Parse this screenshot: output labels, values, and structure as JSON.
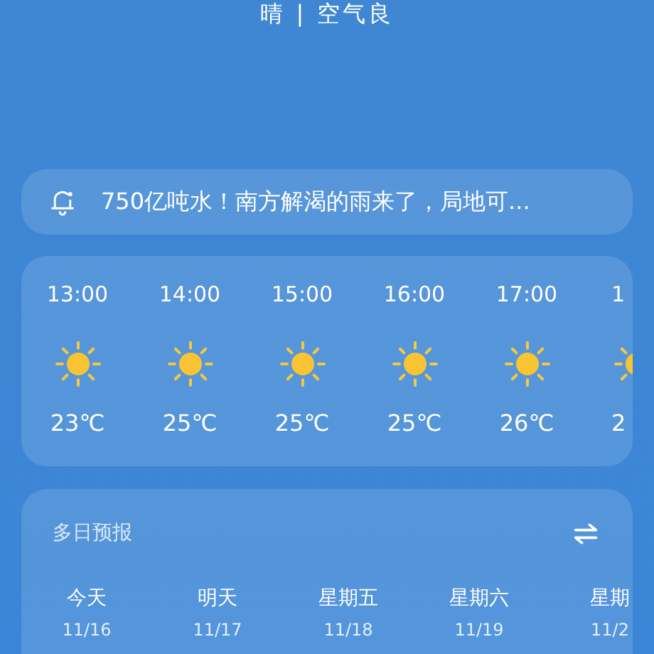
{
  "condition": "晴 | 空气良",
  "notice": {
    "text": "750亿吨水！南方解渴的雨来了，局地可..."
  },
  "hourly": [
    {
      "time": "13:00",
      "temp": "23℃"
    },
    {
      "time": "14:00",
      "temp": "25℃"
    },
    {
      "time": "15:00",
      "temp": "25℃"
    },
    {
      "time": "16:00",
      "temp": "25℃"
    },
    {
      "time": "17:00",
      "temp": "26℃"
    },
    {
      "time": "1",
      "temp": "2"
    }
  ],
  "daily": {
    "title": "多日预报",
    "days": [
      {
        "day": "今天",
        "date": "11/16"
      },
      {
        "day": "明天",
        "date": "11/17"
      },
      {
        "day": "星期五",
        "date": "11/18"
      },
      {
        "day": "星期六",
        "date": "11/19"
      },
      {
        "day": "星期",
        "date": "11/2"
      }
    ]
  }
}
